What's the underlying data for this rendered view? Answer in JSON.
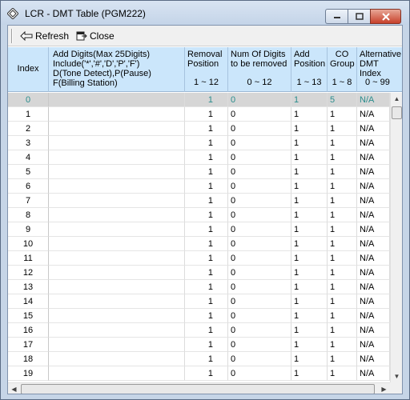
{
  "window": {
    "title": "LCR - DMT Table (PGM222)",
    "icon": "diamond-app-icon"
  },
  "toolbar": {
    "refresh_label": "Refresh",
    "close_label": "Close"
  },
  "columns": [
    {
      "key": "index",
      "lines": [
        "Index"
      ],
      "range": ""
    },
    {
      "key": "add_digits",
      "lines": [
        "Add Digits(Max 25Digits)",
        "Include('*','#','D','P','F')",
        "D(Tone Detect),P(Pause)",
        "F(Billing Station)"
      ],
      "range": ""
    },
    {
      "key": "removal_position",
      "lines": [
        "Removal",
        "Position"
      ],
      "range": "1 ~ 12"
    },
    {
      "key": "num_digits_removed",
      "lines": [
        "Num Of Digits",
        "to be removed"
      ],
      "range": "0 ~ 12"
    },
    {
      "key": "add_position",
      "lines": [
        "Add",
        "Position"
      ],
      "range": "1 ~ 13"
    },
    {
      "key": "co_group",
      "lines": [
        "CO",
        "Group"
      ],
      "range": "1 ~ 8"
    },
    {
      "key": "alternative_dmt_index",
      "lines": [
        "Alternative",
        "DMT Index"
      ],
      "range": "0 ~ 99"
    }
  ],
  "selected_row": 0,
  "rows": [
    {
      "index": "0",
      "add_digits": "",
      "removal_position": "1",
      "num_digits_removed": "0",
      "add_position": "1",
      "co_group": "5",
      "alt_dmt_index": "N/A"
    },
    {
      "index": "1",
      "add_digits": "",
      "removal_position": "1",
      "num_digits_removed": "0",
      "add_position": "1",
      "co_group": "1",
      "alt_dmt_index": "N/A"
    },
    {
      "index": "2",
      "add_digits": "",
      "removal_position": "1",
      "num_digits_removed": "0",
      "add_position": "1",
      "co_group": "1",
      "alt_dmt_index": "N/A"
    },
    {
      "index": "3",
      "add_digits": "",
      "removal_position": "1",
      "num_digits_removed": "0",
      "add_position": "1",
      "co_group": "1",
      "alt_dmt_index": "N/A"
    },
    {
      "index": "4",
      "add_digits": "",
      "removal_position": "1",
      "num_digits_removed": "0",
      "add_position": "1",
      "co_group": "1",
      "alt_dmt_index": "N/A"
    },
    {
      "index": "5",
      "add_digits": "",
      "removal_position": "1",
      "num_digits_removed": "0",
      "add_position": "1",
      "co_group": "1",
      "alt_dmt_index": "N/A"
    },
    {
      "index": "6",
      "add_digits": "",
      "removal_position": "1",
      "num_digits_removed": "0",
      "add_position": "1",
      "co_group": "1",
      "alt_dmt_index": "N/A"
    },
    {
      "index": "7",
      "add_digits": "",
      "removal_position": "1",
      "num_digits_removed": "0",
      "add_position": "1",
      "co_group": "1",
      "alt_dmt_index": "N/A"
    },
    {
      "index": "8",
      "add_digits": "",
      "removal_position": "1",
      "num_digits_removed": "0",
      "add_position": "1",
      "co_group": "1",
      "alt_dmt_index": "N/A"
    },
    {
      "index": "9",
      "add_digits": "",
      "removal_position": "1",
      "num_digits_removed": "0",
      "add_position": "1",
      "co_group": "1",
      "alt_dmt_index": "N/A"
    },
    {
      "index": "10",
      "add_digits": "",
      "removal_position": "1",
      "num_digits_removed": "0",
      "add_position": "1",
      "co_group": "1",
      "alt_dmt_index": "N/A"
    },
    {
      "index": "11",
      "add_digits": "",
      "removal_position": "1",
      "num_digits_removed": "0",
      "add_position": "1",
      "co_group": "1",
      "alt_dmt_index": "N/A"
    },
    {
      "index": "12",
      "add_digits": "",
      "removal_position": "1",
      "num_digits_removed": "0",
      "add_position": "1",
      "co_group": "1",
      "alt_dmt_index": "N/A"
    },
    {
      "index": "13",
      "add_digits": "",
      "removal_position": "1",
      "num_digits_removed": "0",
      "add_position": "1",
      "co_group": "1",
      "alt_dmt_index": "N/A"
    },
    {
      "index": "14",
      "add_digits": "",
      "removal_position": "1",
      "num_digits_removed": "0",
      "add_position": "1",
      "co_group": "1",
      "alt_dmt_index": "N/A"
    },
    {
      "index": "15",
      "add_digits": "",
      "removal_position": "1",
      "num_digits_removed": "0",
      "add_position": "1",
      "co_group": "1",
      "alt_dmt_index": "N/A"
    },
    {
      "index": "16",
      "add_digits": "",
      "removal_position": "1",
      "num_digits_removed": "0",
      "add_position": "1",
      "co_group": "1",
      "alt_dmt_index": "N/A"
    },
    {
      "index": "17",
      "add_digits": "",
      "removal_position": "1",
      "num_digits_removed": "0",
      "add_position": "1",
      "co_group": "1",
      "alt_dmt_index": "N/A"
    },
    {
      "index": "18",
      "add_digits": "",
      "removal_position": "1",
      "num_digits_removed": "0",
      "add_position": "1",
      "co_group": "1",
      "alt_dmt_index": "N/A"
    },
    {
      "index": "19",
      "add_digits": "",
      "removal_position": "1",
      "num_digits_removed": "0",
      "add_position": "1",
      "co_group": "1",
      "alt_dmt_index": "N/A"
    }
  ],
  "colors": {
    "header_bg": "#cbe6fb",
    "selected_row_bg": "#d6d6d6",
    "selected_row_text": "#2a8c8c",
    "close_button": "#c7402a"
  }
}
